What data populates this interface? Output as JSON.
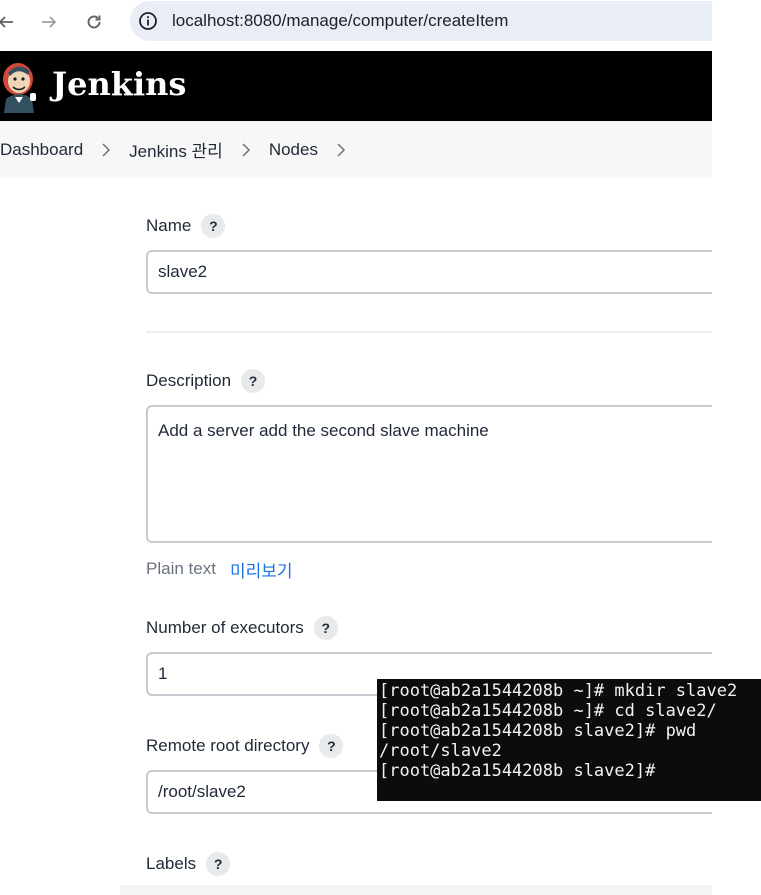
{
  "browser": {
    "url": "localhost:8080/manage/computer/createItem"
  },
  "header": {
    "title": "Jenkins"
  },
  "breadcrumb": {
    "items": [
      "Dashboard",
      "Jenkins 관리",
      "Nodes"
    ]
  },
  "form": {
    "name": {
      "label": "Name",
      "value": "slave2"
    },
    "description": {
      "label": "Description",
      "value": "Add a server add the second slave machine",
      "plain_text": "Plain text",
      "preview": "미리보기"
    },
    "executors": {
      "label": "Number of executors",
      "value": "1"
    },
    "remote_root": {
      "label": "Remote root directory",
      "value": "/root/slave2"
    },
    "labels": {
      "label": "Labels"
    },
    "help": "?"
  },
  "terminal": {
    "lines": [
      "[root@ab2a1544208b ~]# mkdir slave2",
      "[root@ab2a1544208b ~]# cd slave2/",
      "[root@ab2a1544208b slave2]# pwd",
      "/root/slave2",
      "[root@ab2a1544208b slave2]#"
    ]
  },
  "colors": {
    "header_bg": "#000000",
    "link": "#1a73e8",
    "terminal_bg": "#0c0c0c"
  }
}
